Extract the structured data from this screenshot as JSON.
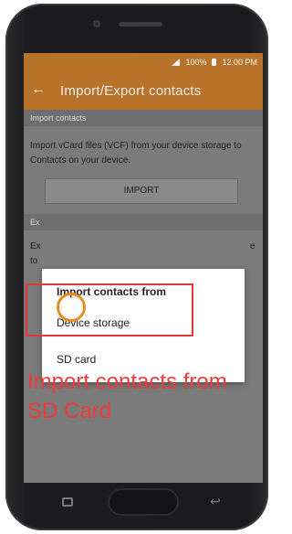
{
  "status_bar": {
    "battery": "100%",
    "time": "12:00 PM"
  },
  "app_bar": {
    "title": "Import/Export contacts"
  },
  "sections": {
    "import": {
      "header": "Import contacts",
      "description": "Import vCard files (VCF) from your device storage to Contacts on your device.",
      "button": "IMPORT"
    },
    "export": {
      "header_partial": "Ex",
      "line1_start": "Ex",
      "line1_end": "e",
      "line2_start": "to"
    }
  },
  "dialog": {
    "title": "Import contacts from",
    "options": [
      "Device storage",
      "SD card"
    ]
  },
  "annotation": {
    "caption_line1": "Import contacts from",
    "caption_line2": "SD Card"
  },
  "colors": {
    "accent": "#b9722a",
    "highlight": "#e53535",
    "circle": "#e98a1d",
    "caption": "#f23a3a"
  },
  "icons": {
    "back": "back-arrow-icon",
    "signal": "signal-icon",
    "battery": "battery-icon"
  }
}
